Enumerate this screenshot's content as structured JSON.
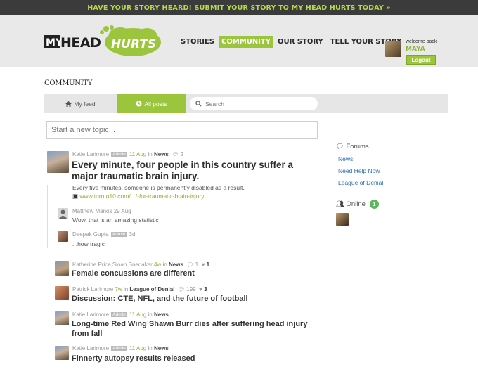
{
  "banner": {
    "text": "HAVE YOUR STORY HEARD!  SUBMIT YOUR STORY TO MY HEAD HURTS TODAY »"
  },
  "header": {
    "logo": {
      "text": "MY HEAD HURTS"
    },
    "nav": [
      {
        "label": "STORIES",
        "active": false
      },
      {
        "label": "COMMUNITY",
        "active": true
      },
      {
        "label": "OUR STORY",
        "active": false
      },
      {
        "label": "TELL YOUR STORY",
        "active": false
      }
    ],
    "user": {
      "welcome": "welcome back",
      "name": "MAYA",
      "logout": "Logout"
    }
  },
  "page": {
    "title": "COMMUNITY"
  },
  "tabs": {
    "feed": "My feed",
    "all": "All posts",
    "search_placeholder": "Search"
  },
  "new_topic": {
    "placeholder": "Start a new topic..."
  },
  "featured": {
    "author": "Katie Larimore",
    "badge": "Admin",
    "date": "11 Aug",
    "in": "in",
    "forum": "News",
    "comments": "2",
    "title": "Every minute, four people in this country suffer a major traumatic brain injury.",
    "body": "Every five minutes, someone is permanently disabled as a result.",
    "link": "www.turnto10.com/.../-for-traumatic-brain-injury",
    "replies": [
      {
        "author": "Matthew Manos",
        "badge": "",
        "date": "29 Aug",
        "text": "Wow, that is an amazing statistic"
      },
      {
        "author": "Deepak Gupta",
        "badge": "Admin",
        "date": "3d",
        "text": "...how tragic"
      }
    ]
  },
  "posts": [
    {
      "author": "Katherine Price Sloan Snedaker",
      "badge": "",
      "date": "4w",
      "in": "in",
      "forum": "News",
      "comments": "1",
      "likes": "1",
      "title": "Female concussions are different"
    },
    {
      "author": "Patrick Larimore",
      "badge": "",
      "date": "7w",
      "in": "in",
      "forum": "League of Denial",
      "comments": "199",
      "likes": "3",
      "title": "Discussion: CTE, NFL, and the future of football"
    },
    {
      "author": "Katie Larimore",
      "badge": "Admin",
      "date": "11 Aug",
      "in": "in",
      "forum": "News",
      "comments": "",
      "likes": "",
      "title": "Long-time Red Wing Shawn Burr dies after suffering head injury from fall"
    },
    {
      "author": "Katie Larimore",
      "badge": "Admin",
      "date": "11 Aug",
      "in": "in",
      "forum": "News",
      "comments": "",
      "likes": "",
      "title": "Finnerty autopsy results released"
    }
  ],
  "sidebar": {
    "forums_label": "Forums",
    "forums": [
      "News",
      "Need Help Now",
      "League of Denial"
    ],
    "online_label": "Online",
    "online_count": "1"
  },
  "colors": {
    "accent": "#9bc53d",
    "link": "#2a6ebb",
    "banner_bg": "#3b3b3b"
  }
}
